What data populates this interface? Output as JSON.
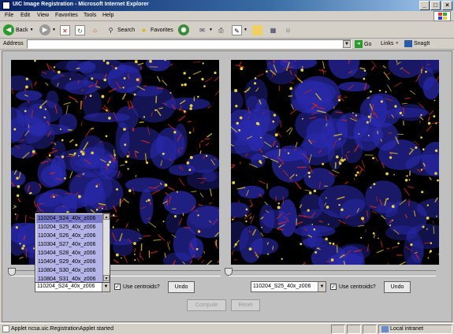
{
  "window": {
    "title": "UIC Image Registration - Microsoft Internet Explorer"
  },
  "menu": [
    "File",
    "Edit",
    "View",
    "Favorites",
    "Tools",
    "Help"
  ],
  "toolbar": {
    "back": "Back",
    "search": "Search",
    "favorites": "Favorites"
  },
  "address": {
    "label": "Address",
    "value": "",
    "go": "Go",
    "links": "Links",
    "snagit": "SnagIt"
  },
  "applet": {
    "left_combo": "110204_S24_40x_z006",
    "right_combo": "110204_S25_40x_z006",
    "use_centroids": "Use centroids?",
    "use_centroids_checked": true,
    "undo": "Undo",
    "compute": "Compute",
    "reset": "Reset",
    "dropdown_items": [
      "110204_S24_40x_z006",
      "110204_S25_40x_z006",
      "110304_S26_40x_z006",
      "110304_S27_40x_z006",
      "110404_S28_40x_z006",
      "110404_S29_40x_z006",
      "110804_S30_40x_z006",
      "110804_S31_40x_z006"
    ]
  },
  "status": {
    "text": "Applet ncsa.uic.RegistrationApplet started",
    "zone": "Local intranet"
  }
}
